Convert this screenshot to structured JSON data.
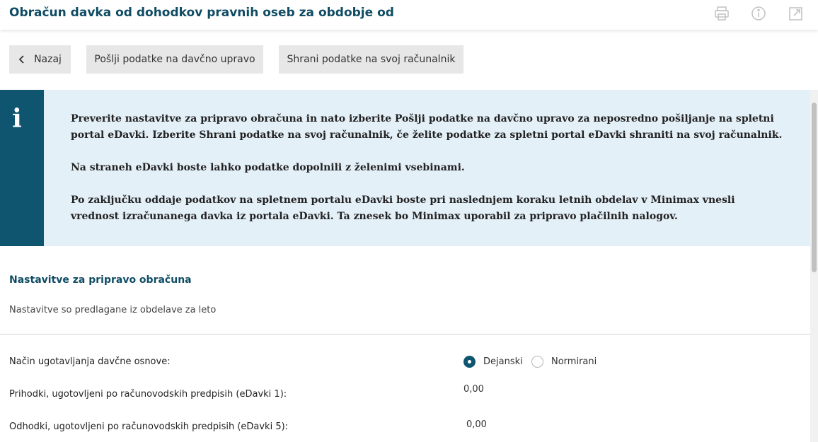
{
  "header": {
    "title": "Obračun davka od dohodkov pravnih oseb za obdobje od",
    "icons": [
      "print-icon",
      "info-icon",
      "external-link-icon"
    ]
  },
  "toolbar": {
    "back_label": "Nazaj",
    "send_label": "Pošlji podatke na davčno upravo",
    "save_label": "Shrani podatke na svoj računalnik"
  },
  "info": {
    "icon_letter": "i",
    "paragraphs": [
      "Preverite nastavitve za pripravo obračuna in nato izberite Pošlji podatke na davčno upravo za neposredno pošiljanje na spletni portal eDavki. Izberite Shrani podatke na svoj računalnik, če želite podatke za spletni portal eDavki shraniti na svoj računalnik.",
      "Na straneh eDavki boste lahko podatke dopolnili z želenimi vsebinami.",
      "Po zaključku oddaje podatkov na spletnem portalu eDavki boste pri naslednjem koraku letnih obdelav v Minimax vnesli vrednost izračunanega davka iz portala eDavki. Ta znesek bo Minimax uporabil za pripravo plačilnih nalogov."
    ]
  },
  "settings": {
    "title": "Nastavitve za pripravo obračuna",
    "subtitle": "Nastavitve so predlagane iz obdelave za leto",
    "method": {
      "label": "Način ugotavljanja davčne osnove:",
      "options": [
        "Dejanski",
        "Normirani"
      ],
      "selected": "Dejanski"
    },
    "revenue": {
      "label": "Prihodki, ugotovljeni po računovodskih predpisih (eDavki 1):",
      "value": "0,00"
    },
    "expenses": {
      "label": "Odhodki, ugotovljeni po računovodskih predpisih (eDavki 5):",
      "value": "0,00"
    }
  },
  "colors": {
    "brand": "#0f4c64",
    "info_strip": "#0f5570",
    "info_bg": "#e4f0f8",
    "button_bg": "#e7e7e7"
  }
}
